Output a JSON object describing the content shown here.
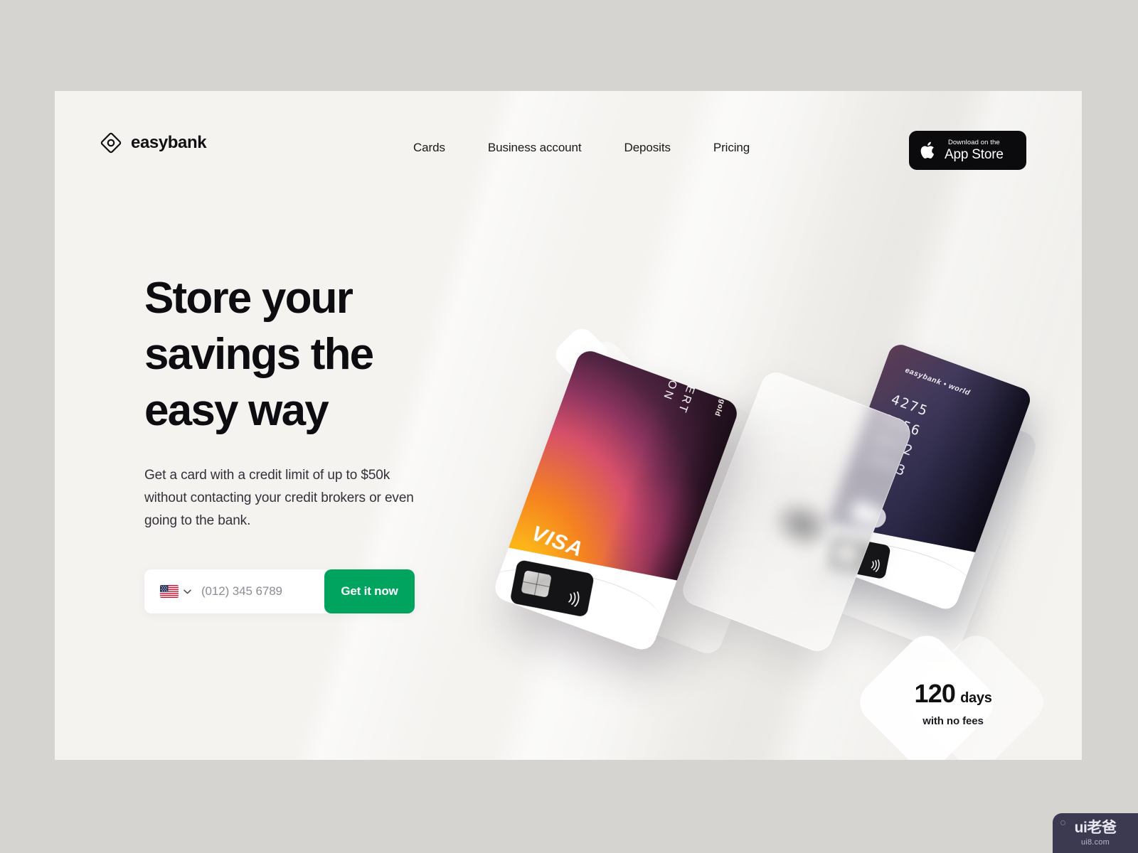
{
  "theme": {
    "outer_bg": "#d5d4d1",
    "panel_bg": "#f4f3f0",
    "accent_green": "#00a45f",
    "ink": "#0d0c10",
    "muted": "#32313a"
  },
  "header": {
    "brand_name": "easybank",
    "brand_mark_icon": "diamond-circle-logo-icon",
    "nav": [
      {
        "label": "Cards"
      },
      {
        "label": "Business account"
      },
      {
        "label": "Deposits"
      },
      {
        "label": "Pricing"
      }
    ],
    "appstore": {
      "icon": "apple-icon",
      "small_label": "Download on the",
      "big_label": "App Store"
    }
  },
  "hero": {
    "title": "Store your savings the easy way",
    "subtitle": "Get a card with a credit limit of up to $50k without contacting your credit brokers or even going to the bank.",
    "form": {
      "country_flag_icon": "us-flag-icon",
      "chevron_icon": "chevron-down-icon",
      "phone_placeholder": "(012) 345 6789",
      "phone_value": "",
      "cta_label": "Get it now"
    }
  },
  "artwork": {
    "gold_card": {
      "brand_label": "easybank • gold",
      "holder_line1": "ROBERT",
      "holder_line2": "MARON",
      "network": "VISA",
      "chip_icon": "emv-chip-icon",
      "contactless_icon": "contactless-icon"
    },
    "dark_card": {
      "brand_label": "easybank • world",
      "number_group_1": "4275",
      "number_group_2": "3156",
      "number_group_3": "0372",
      "number_group_4": "5493",
      "network_icon": "mastercard-icon",
      "chip_icon": "emv-chip-icon"
    },
    "badge": {
      "number": "120",
      "unit": "days",
      "caption": "with no fees"
    }
  },
  "watermark": {
    "main": "ui老爸",
    "sub": "ui8.com"
  }
}
